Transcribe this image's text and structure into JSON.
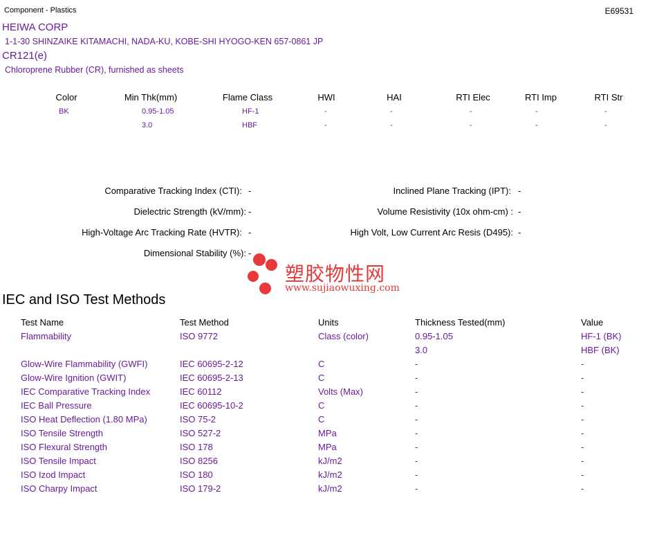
{
  "header": {
    "category": "Component - Plastics",
    "file_number": "E69531"
  },
  "company": {
    "name": "HEIWA CORP",
    "address": "1-1-30 SHINZAIKE KITAMACHI, NADA-KU, KOBE-SHI  HYOGO-KEN  657-0861 JP"
  },
  "product": {
    "name": "CR121(e)",
    "description": "Chloroprene Rubber (CR), furnished as sheets"
  },
  "ratings": {
    "headers": [
      "Color",
      "Min Thk(mm)",
      "Flame Class",
      "HWI",
      "HAI",
      "RTI Elec",
      "RTI Imp",
      "RTI Str"
    ],
    "rows": [
      [
        "BK",
        "0.95-1.05",
        "HF-1",
        "-",
        "-",
        "-",
        "-",
        "-"
      ],
      [
        "",
        "3.0",
        "HBF",
        "-",
        "-",
        "-",
        "-",
        "-"
      ]
    ]
  },
  "properties": {
    "cti": {
      "label": "Comparative Tracking Index (CTI):",
      "value": "-"
    },
    "dielectric": {
      "label": "Dielectric Strength (kV/mm):",
      "value": "-"
    },
    "hvtr": {
      "label": "High-Voltage Arc Tracking Rate (HVTR):",
      "value": "-"
    },
    "dimensional": {
      "label": "Dimensional Stability (%):",
      "value": "-"
    },
    "ipt": {
      "label": "Inclined Plane Tracking (IPT):",
      "value": "-"
    },
    "volume_resistivity": {
      "label": "Volume Resistivity (10x ohm-cm) :",
      "value": "-"
    },
    "d495": {
      "label": "High Volt, Low Current Arc Resis (D495):",
      "value": "-"
    }
  },
  "watermark": {
    "cn": "塑胶物性网",
    "url": "www.sujiaowuxing.com",
    "color": "#e23a3a"
  },
  "test_methods": {
    "title": "IEC and ISO Test Methods",
    "headers": [
      "Test Name",
      "Test Method",
      "Units",
      "Thickness Tested(mm)",
      "Value"
    ],
    "rows": [
      [
        "Flammability",
        "ISO 9772",
        "Class (color)",
        "0.95-1.05",
        "HF-1 (BK)"
      ],
      [
        "",
        "",
        "",
        "3.0",
        "HBF (BK)"
      ],
      [
        "Glow-Wire Flammability (GWFI)",
        "IEC 60695-2-12",
        "C",
        "-",
        "-"
      ],
      [
        "Glow-Wire Ignition (GWIT)",
        "IEC 60695-2-13",
        "C",
        "-",
        "-"
      ],
      [
        "IEC Comparative Tracking Index",
        "IEC 60112",
        "Volts (Max)",
        "-",
        "-"
      ],
      [
        "IEC Ball Pressure",
        "IEC 60695-10-2",
        "C",
        "-",
        "-"
      ],
      [
        "ISO Heat Deflection (1.80 MPa)",
        "ISO 75-2",
        "C",
        "-",
        "-"
      ],
      [
        "ISO Tensile Strength",
        "ISO 527-2",
        "MPa",
        "-",
        "-"
      ],
      [
        "ISO Flexural Strength",
        "ISO 178",
        "MPa",
        "-",
        "-"
      ],
      [
        "ISO Tensile Impact",
        "ISO 8256",
        "kJ/m2",
        "-",
        "-"
      ],
      [
        "ISO Izod Impact",
        "ISO 180",
        "kJ/m2",
        "-",
        "-"
      ],
      [
        "ISO Charpy Impact",
        "ISO 179-2",
        "kJ/m2",
        "-",
        "-"
      ]
    ]
  }
}
